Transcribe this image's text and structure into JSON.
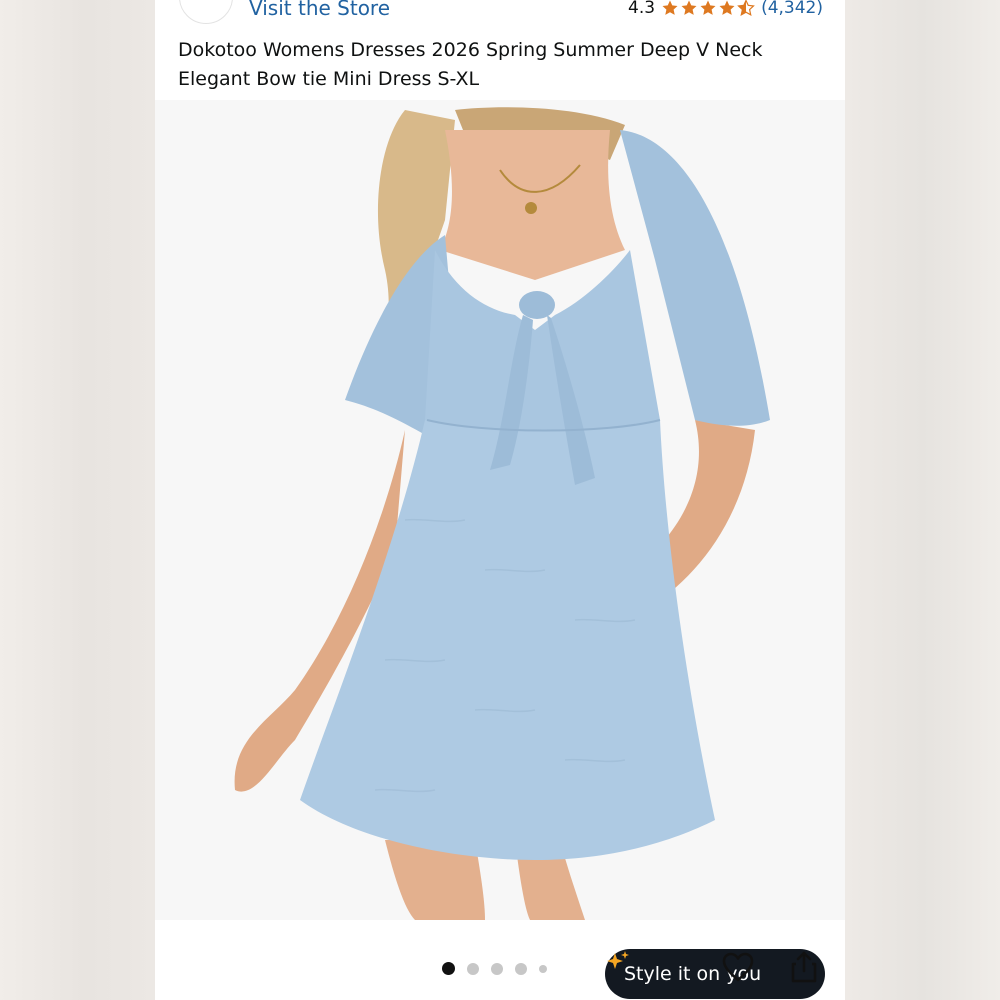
{
  "store": {
    "link_text": "Visit the Store",
    "logo_icon": "store-logo"
  },
  "rating": {
    "value": "4.3",
    "stars_out_of_5": 4.3,
    "count_text": "(4,342)",
    "star_color": "#de7921"
  },
  "product": {
    "title": "Dokotoo Womens Dresses 2026 Spring Summer Deep V Neck Elegant Bow tie Mini Dress S-XL",
    "image_description_icon": "product-photo"
  },
  "style_button": {
    "label": "Style it on you",
    "icon": "sparkle-icon",
    "icon_color": "#f5a623"
  },
  "carousel": {
    "total_dots": 5,
    "active_index": 0
  },
  "actions": {
    "favorite_icon": "heart-icon",
    "share_icon": "share-icon"
  },
  "colors": {
    "link": "#2162a1",
    "chip_bg": "#131921",
    "dress": "#a9c6e0"
  }
}
